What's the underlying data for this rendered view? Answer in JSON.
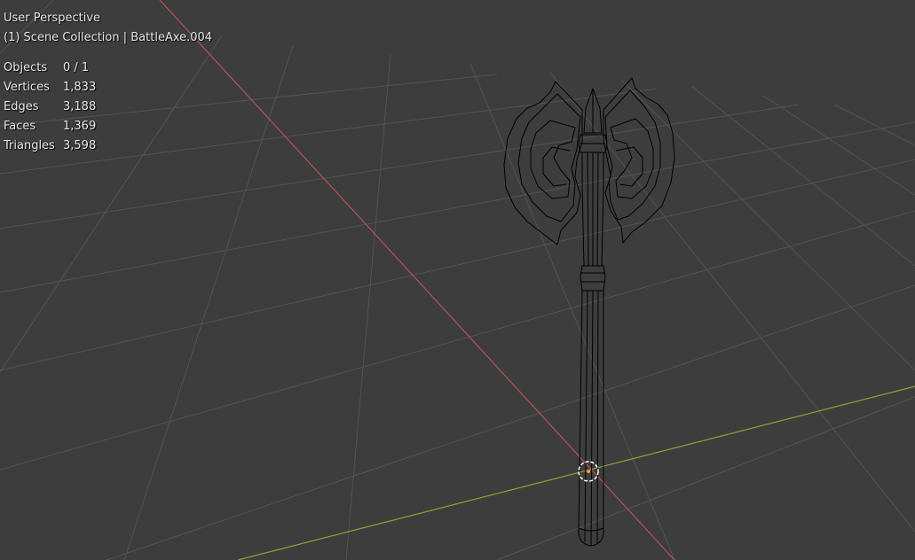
{
  "viewport": {
    "view_name": "User Perspective",
    "collection_info": "(1) Scene Collection | BattleAxe.004",
    "background_color": "#3d3d3d",
    "grid_color": "#535353",
    "x_axis_color": "#b5525f",
    "y_axis_color": "#8aa43a",
    "wire_color": "#000000",
    "origin_color": "#ffffff"
  },
  "stats": [
    {
      "label": "Objects",
      "value": "0 / 1"
    },
    {
      "label": "Vertices",
      "value": "1,833"
    },
    {
      "label": "Edges",
      "value": "3,188"
    },
    {
      "label": "Faces",
      "value": "1,369"
    },
    {
      "label": "Triangles",
      "value": "3,598"
    }
  ]
}
